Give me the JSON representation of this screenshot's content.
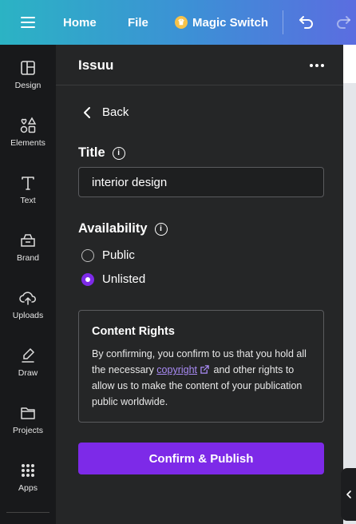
{
  "topbar": {
    "menu_icon": "hamburger-icon",
    "home_label": "Home",
    "file_label": "File",
    "magic_switch_label": "Magic Switch",
    "magic_icon": "crown-icon",
    "undo_icon": "undo-icon",
    "redo_icon": "redo-icon"
  },
  "rail": {
    "items": [
      {
        "label": "Design",
        "icon": "layout-icon"
      },
      {
        "label": "Elements",
        "icon": "shapes-icon"
      },
      {
        "label": "Text",
        "icon": "text-icon"
      },
      {
        "label": "Brand",
        "icon": "brand-icon"
      },
      {
        "label": "Uploads",
        "icon": "cloud-upload-icon"
      },
      {
        "label": "Draw",
        "icon": "pen-icon"
      },
      {
        "label": "Projects",
        "icon": "folder-icon"
      },
      {
        "label": "Apps",
        "icon": "grid-icon"
      }
    ]
  },
  "panel": {
    "title": "Issuu",
    "back_label": "Back",
    "title_label": "Title",
    "title_value": "interior design",
    "availability_label": "Availability",
    "options": [
      {
        "label": "Public",
        "checked": false
      },
      {
        "label": "Unlisted",
        "checked": true
      }
    ],
    "rights": {
      "heading": "Content Rights",
      "text_before": "By confirming, you confirm to us that you hold all the necessary ",
      "link": "copyright",
      "text_after": " and other rights to allow us to make the content of your publication public worldwide."
    },
    "publish_label": "Confirm & Publish"
  },
  "colors": {
    "accent": "#7d2ae8",
    "panel_bg": "#252627",
    "rail_bg": "#18191b"
  }
}
